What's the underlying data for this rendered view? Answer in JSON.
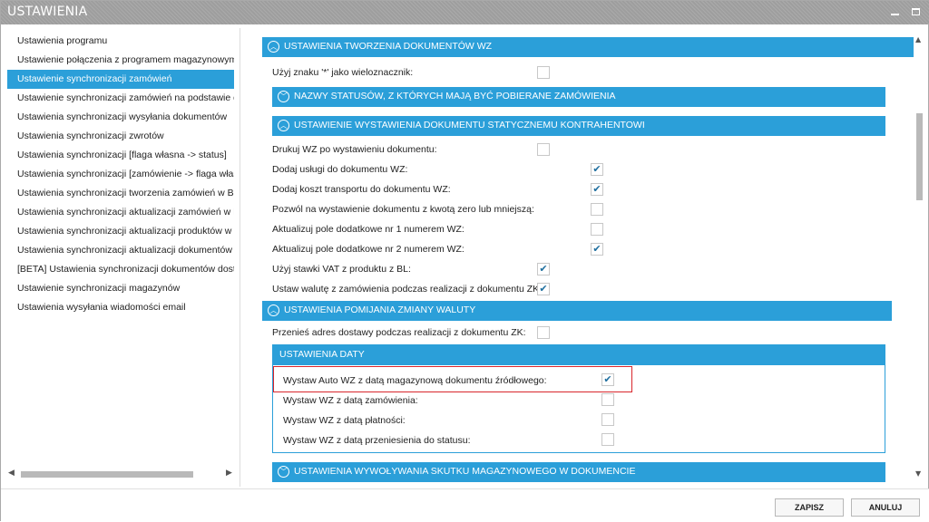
{
  "window": {
    "title": "USTAWIENIA",
    "minimize_icon": "minimize-icon",
    "maximize_icon": "maximize-icon"
  },
  "sidebar": {
    "items": [
      {
        "label": "Ustawienia programu"
      },
      {
        "label": "Ustawienie połączenia z programem magazynowym"
      },
      {
        "label": "Ustawienie synchronizacji zamówień",
        "active": true
      },
      {
        "label": "Ustawienie synchronizacji zamówień na podstawie dzi"
      },
      {
        "label": "Ustawienia synchronizacji wysyłania dokumentów"
      },
      {
        "label": "Ustawienia synchronizacji zwrotów"
      },
      {
        "label": "Ustawienia synchronizacji [flaga własna -> status]"
      },
      {
        "label": "Ustawienia synchronizacji [zamówienie -> flaga własn"
      },
      {
        "label": "Ustawienia synchronizacji tworzenia zamówień w Base"
      },
      {
        "label": "Ustawienia synchronizacji aktualizacji zamówień w Bas"
      },
      {
        "label": "Ustawienia synchronizacji aktualizacji produktów w Ba"
      },
      {
        "label": "Ustawienia synchronizacji aktualizacji dokumentów"
      },
      {
        "label": "[BETA] Ustawienia synchronizacji dokumentów dostaw"
      },
      {
        "label": "Ustawienie synchronizacji magazynów"
      },
      {
        "label": "Ustawienia wysyłania wiadomości email"
      }
    ]
  },
  "main": {
    "sections": [
      {
        "title": "USTAWIENIA TWORZENIA DOKUMENTÓW WZ"
      },
      {
        "title": "NAZWY STATUSÓW, Z KTÓRYCH MAJĄ BYĆ POBIERANE ZAMÓWIENIA"
      },
      {
        "title": "USTAWIENIE WYSTAWIENIA DOKUMENTU STATYCZNEMU KONTRAHENTOWI"
      },
      {
        "title": "USTAWIENIA POMIJANIA ZMIANY WALUTY"
      },
      {
        "title": "USTAWIENIA WYWOŁYWANIA SKUTKU MAGAZYNOWEGO W DOKUMENCIE"
      }
    ],
    "wildcard_row": {
      "label": "Użyj znaku '*' jako wieloznacznik:",
      "checked": false
    },
    "static_rows": [
      {
        "label": "Drukuj WZ po wystawieniu dokumentu:",
        "checked": false
      },
      {
        "label": "Dodaj usługi do dokumentu WZ:",
        "checked": true
      },
      {
        "label": "Dodaj koszt transportu do dokumentu WZ:",
        "checked": true
      },
      {
        "label": "Pozwól na wystawienie dokumentu z kwotą zero lub mniejszą:",
        "checked": false
      },
      {
        "label": "Aktualizuj pole dodatkowe nr 1 numerem WZ:",
        "checked": false
      },
      {
        "label": "Aktualizuj pole dodatkowe nr 2 numerem WZ:",
        "checked": true
      },
      {
        "label": "Użyj stawki VAT z produktu z BL:",
        "checked": true
      },
      {
        "label": "Ustaw walutę z zamówienia podczas realizacji z dokumentu ZK:",
        "checked": true
      }
    ],
    "currency_row": {
      "label": "Przenieś adres dostawy podczas realizacji z dokumentu ZK:",
      "checked": false
    },
    "date_panel": {
      "title": "USTAWIENIA DATY",
      "rows": [
        {
          "label": "Wystaw Auto WZ z datą magazynową dokumentu źródłowego:",
          "checked": true
        },
        {
          "label": "Wystaw WZ z datą zamówienia:",
          "checked": false
        },
        {
          "label": "Wystaw WZ z datą płatności:",
          "checked": false
        },
        {
          "label": "Wystaw WZ z datą przeniesienia do statusu:",
          "checked": false
        }
      ]
    },
    "check_glyph": "✔"
  },
  "footer": {
    "save_label": "ZAPISZ",
    "cancel_label": "ANULUJ"
  },
  "colors": {
    "accent": "#2b9fd9",
    "highlight": "#d9262c",
    "titlebar": "#9e9e9e"
  }
}
